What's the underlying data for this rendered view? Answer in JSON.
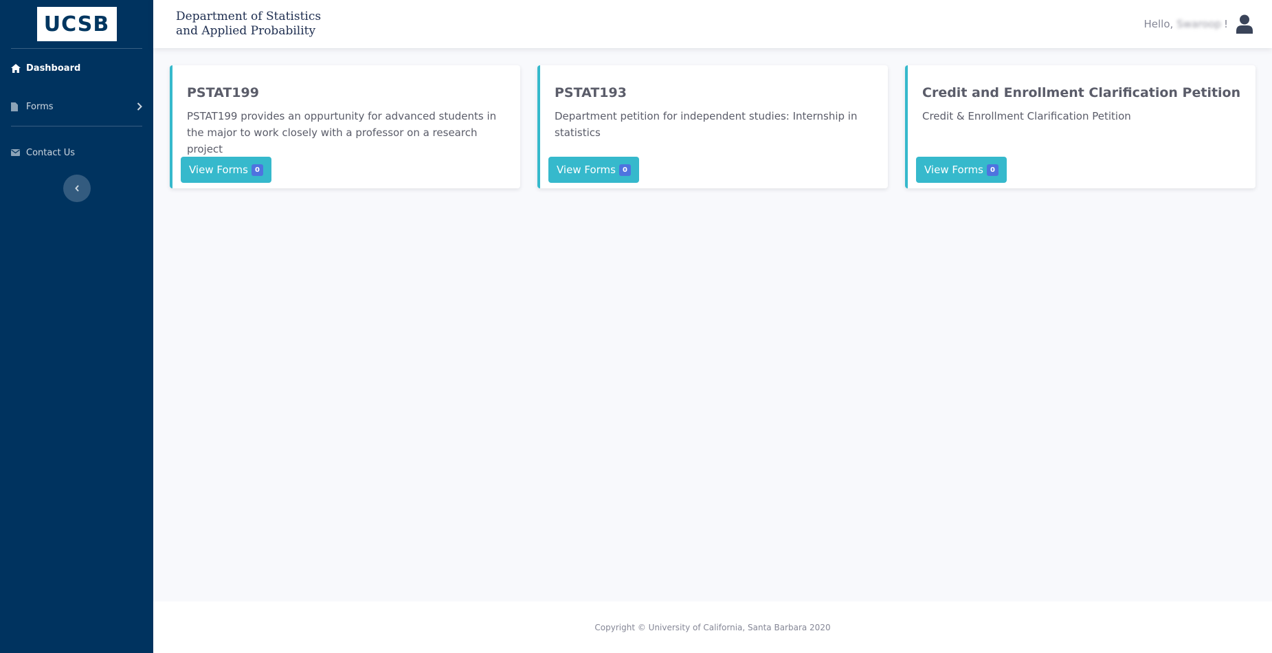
{
  "sidebar": {
    "brand": "UCSB",
    "items": [
      {
        "label": "Dashboard",
        "icon": "home-icon"
      },
      {
        "label": "Forms",
        "icon": "file-icon"
      },
      {
        "label": "Contact Us",
        "icon": "envelope-icon"
      }
    ]
  },
  "header": {
    "dept_line1": "Department of Statistics",
    "dept_line2": "and Applied Probability",
    "greeting": "Hello,",
    "username": "Swaroop",
    "exclaim": "!"
  },
  "cards": [
    {
      "title": "PSTAT199",
      "description": "PSTAT199 provides an oppurtunity for advanced students in the major to work closely with a professor on a research project",
      "button_label": "View Forms",
      "count": "0"
    },
    {
      "title": "PSTAT193",
      "description": "Department petition for independent studies: Internship in statistics",
      "button_label": "View Forms",
      "count": "0"
    },
    {
      "title": "Credit and Enrollment Clarification Petition",
      "description": "Credit & Enrollment Clarification Petition",
      "button_label": "View Forms",
      "count": "0"
    }
  ],
  "footer": {
    "copyright": "Copyright © University of California, Santa Barbara 2020"
  },
  "colors": {
    "sidebar_bg": "#00335f",
    "accent": "#36b9cc",
    "badge": "#4e73df"
  }
}
